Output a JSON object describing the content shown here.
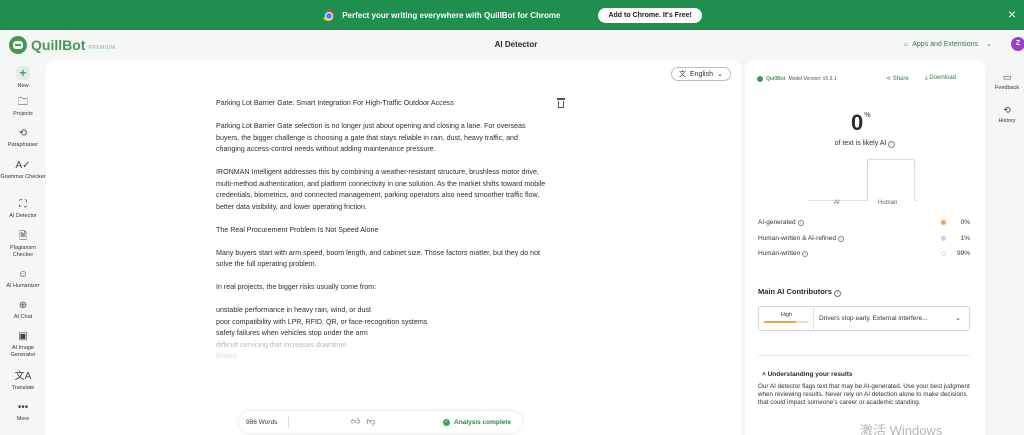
{
  "banner": {
    "text": "Perfect your writing everywhere with QuillBot for Chrome",
    "cta": "Add to Chrome. It's Free!",
    "close": "×"
  },
  "header": {
    "brand": "QuillBot",
    "tier": "PREMIUM",
    "title": "AI Detector",
    "apps": "Apps and Extensions",
    "avatar": "Z"
  },
  "sidebar": {
    "items": [
      {
        "label": "New",
        "icon": "plus-icon"
      },
      {
        "label": "Projects",
        "icon": "folder-icon"
      },
      {
        "label": "Paraphraser",
        "icon": "cycle-icon"
      },
      {
        "label": "Grammar Checker",
        "icon": "spellcheck-icon"
      },
      {
        "label": "AI Detector",
        "icon": "scan-icon"
      },
      {
        "label": "Plagiarism Checker",
        "icon": "document-check-icon"
      },
      {
        "label": "AI Humanizer",
        "icon": "humanizer-icon"
      },
      {
        "label": "AI Chat",
        "icon": "chat-icon"
      },
      {
        "label": "AI Image Generator",
        "icon": "image-icon"
      },
      {
        "label": "Translate",
        "icon": "translate-icon"
      },
      {
        "label": "More",
        "icon": "more-icon"
      }
    ]
  },
  "editor": {
    "language": "English",
    "paragraphs": [
      "Parking Lot Barrier Gate: Smart Integration For High-Traffic Outdoor Access",
      "Parking Lot Barrier Gate selection is no longer just about opening and closing a lane. For overseas buyers, the bigger challenge is choosing a gate that stays reliable in rain, dust, heavy traffic, and changing access-control needs without adding maintenance pressure.",
      "IRONMAN Intelligent addresses this by combining a weather-resistant structure, brushless motor drive, multi-method authentication, and platform connectivity in one solution. As the market shifts toward mobile credentials, biometrics, and connected management, parking operators also need smoother traffic flow, better data visibility, and lower operating friction.",
      "The Real Procurement Problem Is Not Speed Alone",
      "Many buyers start with arm speed, boom length, and cabinet size. Those factors matter, but they do not solve the full operating problem.",
      "In real projects, the bigger risks usually come from:"
    ],
    "list": [
      "unstable performance in heavy rain, wind, or dust",
      "poor compatibility with LPR, RFID, QR, or face-recognition systems",
      "safety failures when vehicles stop under the arm",
      "difficult servicing that increases downtime",
      "limited"
    ],
    "word_count": "986 Words",
    "status": "Analysis complete"
  },
  "results": {
    "brand": "QuillBot",
    "model_version": "Model Version: v5.9.1",
    "share": "Share",
    "download": "Download",
    "score": "0",
    "score_unit": "%",
    "score_label": "of text is likely AI",
    "chart_labels": [
      "AI",
      "Human"
    ],
    "metrics": [
      {
        "label": "AI-generated",
        "value": "0%",
        "color": "#f5a25d"
      },
      {
        "label": "Human-written & AI-refined",
        "value": "1%",
        "color": "#c9cfe8"
      },
      {
        "label": "Human-written",
        "value": "99%",
        "color": "#ffffff"
      }
    ],
    "contributors_title": "Main AI Contributors",
    "contributor_level": "High",
    "contributor_text": "Drivers stop early. External interfere...",
    "understanding_title": "Understanding your results",
    "understanding_text": "Our AI detector flags text that may be AI-generated. Use your best judgment when reviewing results. Never rely on AI detection alone to make decisions that could impact someone's career or academic standing."
  },
  "rightbar": {
    "feedback": "Feedback",
    "history": "History"
  },
  "watermark": "激活 Windows"
}
